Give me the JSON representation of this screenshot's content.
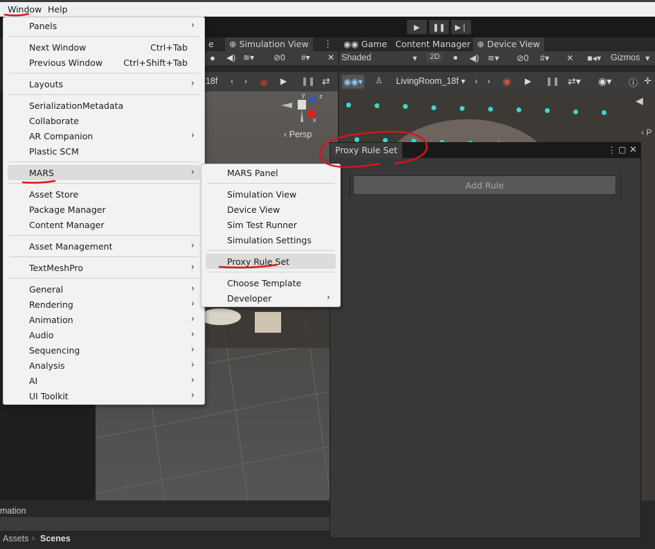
{
  "menubar": {
    "window": "Window",
    "help": "Help"
  },
  "scene": {
    "tab_partial": "e",
    "simulation_tab": "Simulation View",
    "frame_partial": "18f",
    "persp": "Persp",
    "axis_y": "y",
    "axis_z": "z",
    "axis_x": "x"
  },
  "device": {
    "game_tab": "Game",
    "content_manager_tab": "Content Manager",
    "device_tab": "Device View",
    "shaded": "Shaded",
    "mode_2d": "2D",
    "hidden_count": "0",
    "gizmos": "Gizmos",
    "environment": "LivingRoom_18f",
    "persp_partial": "P"
  },
  "proxy_panel": {
    "tab": "Proxy Rule Set",
    "add_rule": "Add Rule"
  },
  "bottom": {
    "animation_partial": "mation",
    "assets": "Assets",
    "scenes": "Scenes"
  },
  "window_menu": {
    "panels": "Panels",
    "next_window": "Next Window",
    "next_window_sc": "Ctrl+Tab",
    "previous_window": "Previous Window",
    "previous_window_sc": "Ctrl+Shift+Tab",
    "layouts": "Layouts",
    "serialization_metadata": "SerializationMetadata",
    "collaborate": "Collaborate",
    "ar_companion": "AR Companion",
    "plastic_scm": "Plastic SCM",
    "mars": "MARS",
    "asset_store": "Asset Store",
    "package_manager": "Package Manager",
    "content_manager": "Content Manager",
    "asset_management": "Asset Management",
    "textmeshpro": "TextMeshPro",
    "general": "General",
    "rendering": "Rendering",
    "animation": "Animation",
    "audio": "Audio",
    "sequencing": "Sequencing",
    "analysis": "Analysis",
    "ai": "AI",
    "ui_toolkit": "UI Toolkit"
  },
  "mars_submenu": {
    "mars_panel": "MARS Panel",
    "simulation_view": "Simulation View",
    "device_view": "Device View",
    "sim_test_runner": "Sim Test Runner",
    "simulation_settings": "Simulation Settings",
    "proxy_rule_set": "Proxy Rule Set",
    "choose_template": "Choose Template",
    "developer": "Developer"
  },
  "colors": {
    "annotation_red": "#d8141a",
    "menu_bg": "#f2f2f2",
    "point_cloud": "#3fd6cf"
  }
}
